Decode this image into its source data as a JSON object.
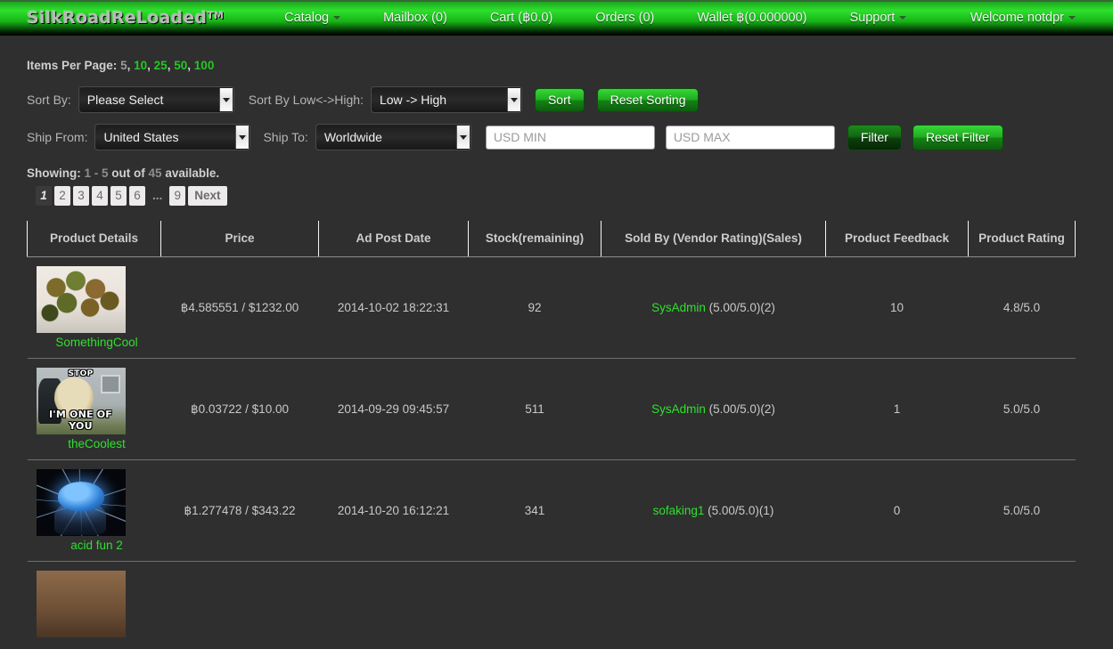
{
  "navbar": {
    "brand": "SilkRoadReLoaded",
    "brand_tm": "TM",
    "items": [
      {
        "label": "Catalog",
        "caret": true
      },
      {
        "label": "Mailbox (0)",
        "caret": false
      },
      {
        "label": "Cart (฿0.0)",
        "caret": false
      },
      {
        "label": "Orders (0)",
        "caret": false
      },
      {
        "label": "Wallet ฿(0.000000)",
        "caret": false
      },
      {
        "label": "Support",
        "caret": true
      }
    ],
    "welcome": "Welcome notdpr"
  },
  "items_per_page": {
    "label": "Items Per Page:",
    "current": "5",
    "options": [
      "10",
      "25",
      "50",
      "100"
    ]
  },
  "controls": {
    "sort_by_label": "Sort By:",
    "sort_by_value": "Please Select",
    "sort_dir_label": "Sort By Low<->High:",
    "sort_dir_value": "Low -> High",
    "sort_button": "Sort",
    "reset_sorting_button": "Reset Sorting",
    "ship_from_label": "Ship From:",
    "ship_from_value": "United States",
    "ship_to_label": "Ship To:",
    "ship_to_value": "Worldwide",
    "usd_min_placeholder": "USD MIN",
    "usd_min_value": "",
    "usd_max_placeholder": "USD MAX",
    "usd_max_value": "",
    "filter_button": "Filter",
    "reset_filter_button": "Reset Filter"
  },
  "showing": {
    "prefix": "Showing:",
    "range": "1 - 5",
    "middle": "out of",
    "total": "45",
    "suffix": "available."
  },
  "pagination": {
    "pages": [
      "1",
      "2",
      "3",
      "4",
      "5",
      "6",
      "...",
      "9"
    ],
    "active": "1",
    "next_label": "Next"
  },
  "table": {
    "headers": [
      "Product Details",
      "Price",
      "Ad Post Date",
      "Stock(remaining)",
      "Sold By (Vendor Rating)(Sales)",
      "Product Feedback",
      "Product Rating"
    ],
    "rows": [
      {
        "product_name": "SomethingCool",
        "thumb": "cannabis-buds-photo",
        "price": "฿4.585551 / $1232.00",
        "ad_post_date": "2014-10-02 18:22:31",
        "stock": "92",
        "vendor": "SysAdmin",
        "vendor_rating": "(5.00/5.0)(2)",
        "product_feedback": "10",
        "product_rating": "4.8/5.0"
      },
      {
        "product_name": "theCoolest",
        "thumb": "dog-police-meme-photo",
        "thumb_text_top": "STOP",
        "thumb_text_bottom": "I'M ONE OF YOU",
        "price": "฿0.03722 / $10.00",
        "ad_post_date": "2014-09-29 09:45:57",
        "stock": "511",
        "vendor": "SysAdmin",
        "vendor_rating": "(5.00/5.0)(2)",
        "product_feedback": "1",
        "product_rating": "5.0/5.0"
      },
      {
        "product_name": "acid fun 2",
        "thumb": "glowing-blue-brain-photo",
        "price": "฿1.277478 / $343.22",
        "ad_post_date": "2014-10-20 16:12:21",
        "stock": "341",
        "vendor": "sofaking1",
        "vendor_rating": "(5.00/5.0)(1)",
        "product_feedback": "0",
        "product_rating": "5.0/5.0"
      }
    ]
  },
  "colors": {
    "accent_green": "#2ee02e",
    "link_green": "#23c723",
    "page_background": "#2f2f2f",
    "text": "#c9c9c9"
  }
}
